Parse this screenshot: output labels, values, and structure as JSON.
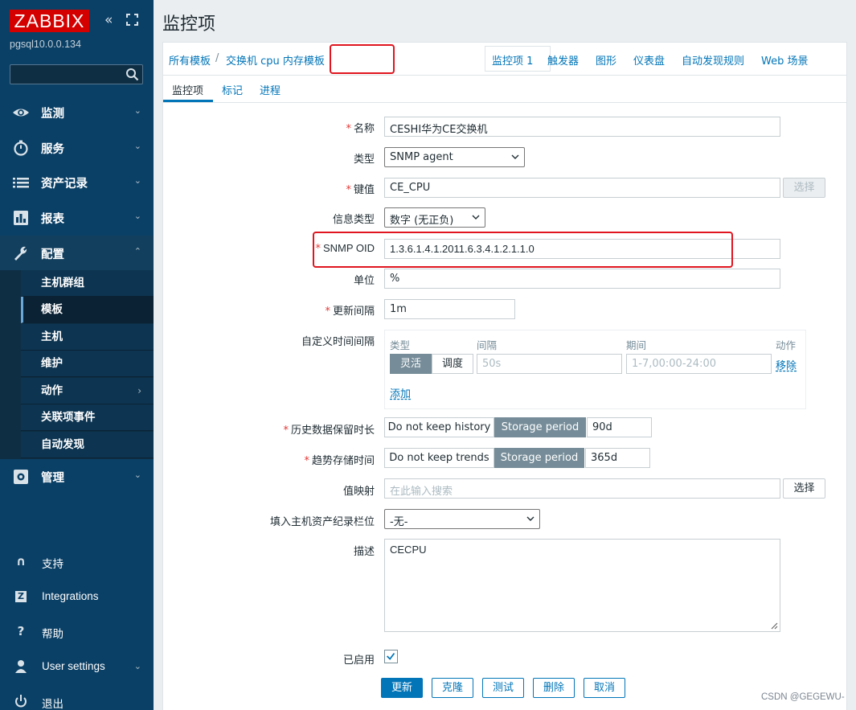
{
  "sidebar": {
    "logo": "ZABBIX",
    "server_name": "pgsql10.0.0.134",
    "search_placeholder": "",
    "nav": [
      {
        "label": "监测",
        "icon": "eye-icon"
      },
      {
        "label": "服务",
        "icon": "stopwatch-icon"
      },
      {
        "label": "资产记录",
        "icon": "list-icon"
      },
      {
        "label": "报表",
        "icon": "bar-chart-icon"
      },
      {
        "label": "配置",
        "icon": "wrench-icon"
      }
    ],
    "submenu": [
      "主机群组",
      "模板",
      "主机",
      "维护",
      "动作",
      "关联项事件",
      "自动发现"
    ],
    "admin": {
      "label": "管理",
      "icon": "gear-icon"
    },
    "footer": [
      {
        "label": "支持",
        "icon": "headset-icon"
      },
      {
        "label": "Integrations",
        "icon": "z-icon"
      },
      {
        "label": "帮助",
        "icon": "question-icon"
      },
      {
        "label": "User settings",
        "icon": "user-icon"
      },
      {
        "label": "退出",
        "icon": "power-icon"
      }
    ]
  },
  "page": {
    "title": "监控项",
    "breadcrumbs": [
      "所有模板",
      "交换机 cpu 内存模板",
      "监控项 1",
      "触发器",
      "图形",
      "仪表盘",
      "自动发现规则",
      "Web 场景"
    ],
    "breadcrumb_sep": "/",
    "tabs": [
      "监控项",
      "标记",
      "进程"
    ]
  },
  "form": {
    "name_label": "名称",
    "name_value": "CESHI华为CE交换机",
    "type_label": "类型",
    "type_value": "SNMP agent",
    "key_label": "键值",
    "key_value": "CE_CPU",
    "key_select_button": "选择",
    "info_type_label": "信息类型",
    "info_type_value": "数字 (无正负)",
    "oid_label": "SNMP OID",
    "oid_value": "1.3.6.1.4.1.2011.6.3.4.1.2.1.1.0",
    "unit_label": "单位",
    "unit_value": "%",
    "interval_label": "更新间隔",
    "interval_value": "1m",
    "custom_label": "自定义时间间隔",
    "custom_headers": {
      "type": "类型",
      "interval": "间隔",
      "period": "期间",
      "action": "动作"
    },
    "custom_flexible": "灵活",
    "custom_scheduling": "调度",
    "custom_interval_ph": "50s",
    "custom_period_ph": "1-7,00:00-24:00",
    "custom_remove": "移除",
    "custom_add": "添加",
    "history_label": "历史数据保留时长",
    "history_no_keep": "Do not keep history",
    "history_storage": "Storage period",
    "history_value": "90d",
    "trends_label": "趋势存储时间",
    "trends_no_keep": "Do not keep trends",
    "trends_storage": "Storage period",
    "trends_value": "365d",
    "valuemap_label": "值映射",
    "valuemap_placeholder": "在此输入搜索",
    "valuemap_button": "选择",
    "inventory_label": "填入主机资产纪录栏位",
    "inventory_value": "-无-",
    "desc_label": "描述",
    "desc_value": "CECPU",
    "enabled_label": "已启用",
    "enabled": true
  },
  "buttons": {
    "update": "更新",
    "clone": "克隆",
    "test": "测试",
    "delete": "删除",
    "cancel": "取消"
  },
  "watermark": "CSDN @GEGEWU-",
  "colors": {
    "brand_red": "#d40000",
    "sidebar": "#0b4066",
    "link": "#0275b8",
    "annotation": "#e0151f"
  }
}
